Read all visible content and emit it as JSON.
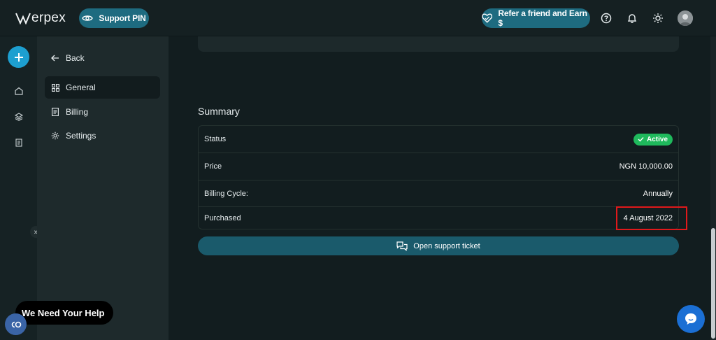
{
  "header": {
    "logo_text": "erpex",
    "support_pin_label": "Support PIN",
    "refer_label": "Refer a friend and Earn $",
    "icons": [
      "help-icon",
      "bell-icon",
      "sun-icon",
      "avatar"
    ]
  },
  "rail": {
    "icons": [
      "plus-icon",
      "home-icon",
      "layers-icon",
      "document-icon"
    ],
    "expand_label": "»"
  },
  "sidebar": {
    "back_label": "Back",
    "items": [
      {
        "label": "General",
        "icon": "grid-icon",
        "active": true
      },
      {
        "label": "Billing",
        "icon": "receipt-icon",
        "active": false
      },
      {
        "label": "Settings",
        "icon": "gear-icon",
        "active": false
      }
    ]
  },
  "main": {
    "summary_title": "Summary",
    "rows": [
      {
        "label": "Status",
        "value": "Active"
      },
      {
        "label": "Price",
        "value": "NGN 10,000.00"
      },
      {
        "label": "Billing Cycle:",
        "value": "Annually"
      },
      {
        "label": "Purchased",
        "value": "4 August 2022"
      }
    ],
    "ticket_button_label": "Open support ticket"
  },
  "floating": {
    "help_text": "We Need Your Help"
  },
  "colors": {
    "accent": "#1d9fd0",
    "pill": "#1e6b80",
    "status_active": "#1fb95c",
    "highlight": "#e0191b"
  }
}
